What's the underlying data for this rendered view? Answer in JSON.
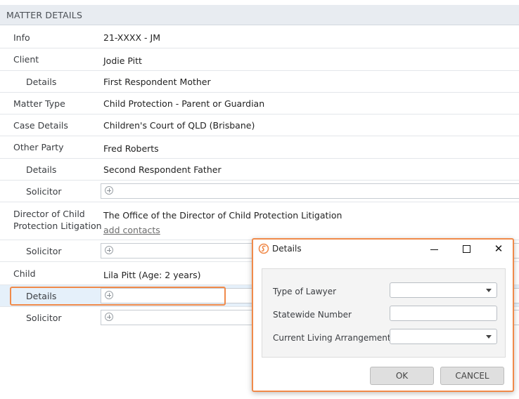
{
  "section": {
    "title": "MATTER DETAILS"
  },
  "rows": {
    "info": {
      "label": "Info",
      "value": "21-XXXX - JM"
    },
    "client": {
      "label": "Client",
      "value": "Jodie Pitt"
    },
    "client_details": {
      "label": "Details",
      "value": "First Respondent Mother"
    },
    "matter_type": {
      "label": "Matter Type",
      "value": "Child Protection - Parent or Guardian"
    },
    "case_details": {
      "label": "Case Details",
      "value": "Children's Court of QLD (Brisbane)"
    },
    "other_party": {
      "label": "Other Party",
      "value": "Fred Roberts"
    },
    "other_party_details": {
      "label": "Details",
      "value": "Second Respondent Father"
    },
    "other_party_solicitor": {
      "label": "Solicitor"
    },
    "director": {
      "label_line1": "Director of Child",
      "label_line2": "Protection Litigation",
      "value": "The Office of the Director of Child Protection Litigation",
      "link": "add contacts"
    },
    "director_solicitor": {
      "label": "Solicitor"
    },
    "child": {
      "label": "Child",
      "value": "Lila Pitt (Age: 2 years)"
    },
    "child_details": {
      "label": "Details"
    },
    "child_solicitor": {
      "label": "Solicitor"
    }
  },
  "dialog": {
    "title": "Details",
    "close_glyph": "✕",
    "fields": {
      "type_of_lawyer": {
        "label": "Type of Lawyer",
        "value": ""
      },
      "statewide_number": {
        "label": "Statewide Number",
        "value": ""
      },
      "living_arrangements": {
        "label": "Current Living Arrangements",
        "value": ""
      }
    },
    "ok_label": "OK",
    "cancel_label": "CANCEL"
  },
  "colors": {
    "accent": "#f08a4a",
    "header_bg": "#e8ecf1",
    "row_highlight": "#e5f0fa"
  },
  "icons": {
    "add": "plus-circle-icon",
    "logo": "app-logo-icon",
    "dropdown": "chevron-down-icon"
  }
}
